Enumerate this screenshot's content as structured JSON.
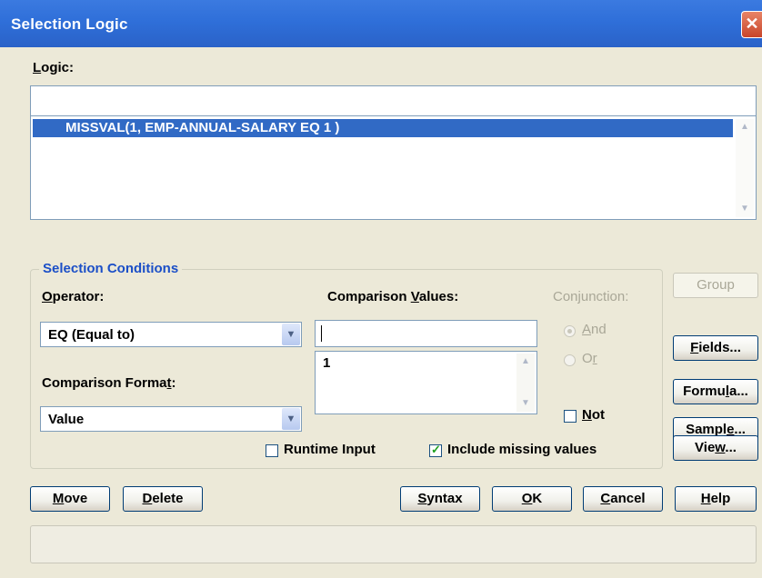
{
  "window": {
    "title": "Selection Logic",
    "close_glyph": "✕"
  },
  "logic": {
    "label_prefix": "",
    "label_underline": "L",
    "label_rest": "ogic:",
    "input_value": "",
    "selected_line": "MISSVAL(1, EMP-ANNUAL-SALARY EQ 1 )"
  },
  "conditions": {
    "caption": "Selection Conditions",
    "operator_label_prefix": "",
    "operator_label_underline": "O",
    "operator_label_rest": "perator:",
    "operator_value": "EQ (Equal to)",
    "format_label_prefix": "Comparison Forma",
    "format_label_underline": "t",
    "format_label_rest": ":",
    "format_value": "Value",
    "values_label_prefix": "Comparison ",
    "values_label_underline": "V",
    "values_label_rest": "alues:",
    "values_input": "",
    "values_list": [
      "1"
    ],
    "conjunction_label": "Conjunction:",
    "and_prefix": "",
    "and_underline": "A",
    "and_rest": "nd",
    "or_prefix": "O",
    "or_underline": "r",
    "or_rest": "",
    "not_prefix": "",
    "not_underline": "N",
    "not_rest": "ot",
    "runtime_label": "Runtime Input",
    "include_missing_label": "Include missing values",
    "include_missing_checked": true
  },
  "side_buttons": {
    "group": "Group",
    "fields_prefix": "",
    "fields_underline": "F",
    "fields_rest": "ields...",
    "formula_prefix": "Formu",
    "formula_underline": "l",
    "formula_rest": "a...",
    "sample_prefix": "Sampl",
    "sample_underline": "e",
    "sample_rest": "...",
    "view_prefix": "Vie",
    "view_underline": "w",
    "view_rest": "..."
  },
  "bottom_buttons": {
    "move_prefix": "",
    "move_underline": "M",
    "move_rest": "ove",
    "delete_prefix": "",
    "delete_underline": "D",
    "delete_rest": "elete",
    "syntax_prefix": "",
    "syntax_underline": "S",
    "syntax_rest": "yntax",
    "ok_prefix": "",
    "ok_underline": "O",
    "ok_rest": "K",
    "cancel_prefix": "",
    "cancel_underline": "C",
    "cancel_rest": "ancel",
    "help_prefix": "",
    "help_underline": "H",
    "help_rest": "elp"
  },
  "status": {
    "text": ""
  },
  "icons": {
    "dropdown": "chevron-down-icon",
    "scroll_up": "scroll-up-icon",
    "scroll_down": "scroll-down-icon"
  },
  "colors": {
    "titlebar": "#2f6fd9",
    "selection": "#316ac5",
    "group_caption": "#1b4fc7"
  }
}
